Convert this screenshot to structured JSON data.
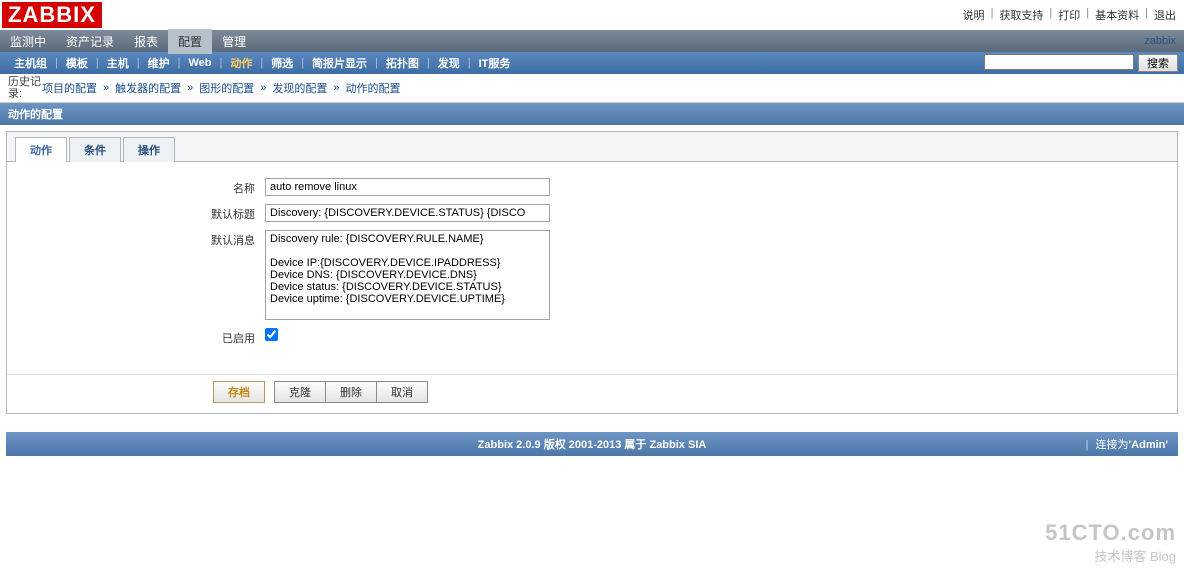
{
  "logo": "ZABBIX",
  "top_links": {
    "help": "说明",
    "support": "获取支持",
    "print": "打印",
    "profile": "基本资料",
    "logout": "退出"
  },
  "user_label": "zabbix",
  "main_menu": [
    "监测中",
    "资产记录",
    "报表",
    "配置",
    "管理"
  ],
  "main_menu_active": 3,
  "sub_menu": [
    "主机组",
    "模板",
    "主机",
    "维护",
    "Web",
    "动作",
    "筛选",
    "简报片显示",
    "拓扑图",
    "发现",
    "IT服务"
  ],
  "sub_menu_active": 5,
  "search": {
    "placeholder": "",
    "button": "搜索"
  },
  "history": {
    "label": "历史记录:",
    "items": [
      "项目的配置",
      "触发器的配置",
      "图形的配置",
      "发现的配置",
      "动作的配置"
    ]
  },
  "section_title": "动作的配置",
  "tabs": [
    "动作",
    "条件",
    "操作"
  ],
  "tabs_active": 0,
  "form": {
    "name_label": "名称",
    "name_value": "auto remove linux",
    "subject_label": "默认标题",
    "subject_value": "Discovery: {DISCOVERY.DEVICE.STATUS} {DISCO",
    "message_label": "默认消息",
    "message_value": "Discovery rule: {DISCOVERY.RULE.NAME}\n\nDevice IP:{DISCOVERY.DEVICE.IPADDRESS}\nDevice DNS: {DISCOVERY.DEVICE.DNS}\nDevice status: {DISCOVERY.DEVICE.STATUS}\nDevice uptime: {DISCOVERY.DEVICE.UPTIME}",
    "enabled_label": "已启用",
    "enabled": true
  },
  "buttons": {
    "save": "存档",
    "clone": "克隆",
    "delete": "删除",
    "cancel": "取消"
  },
  "footer": {
    "center": "Zabbix 2.0.9 版权 2001-2013 属于 Zabbix SIA",
    "right_prefix": "连接为",
    "right_user": "'Admin'"
  },
  "watermark": {
    "top": "51CTO.com",
    "bot": "技术博客  Blog"
  }
}
